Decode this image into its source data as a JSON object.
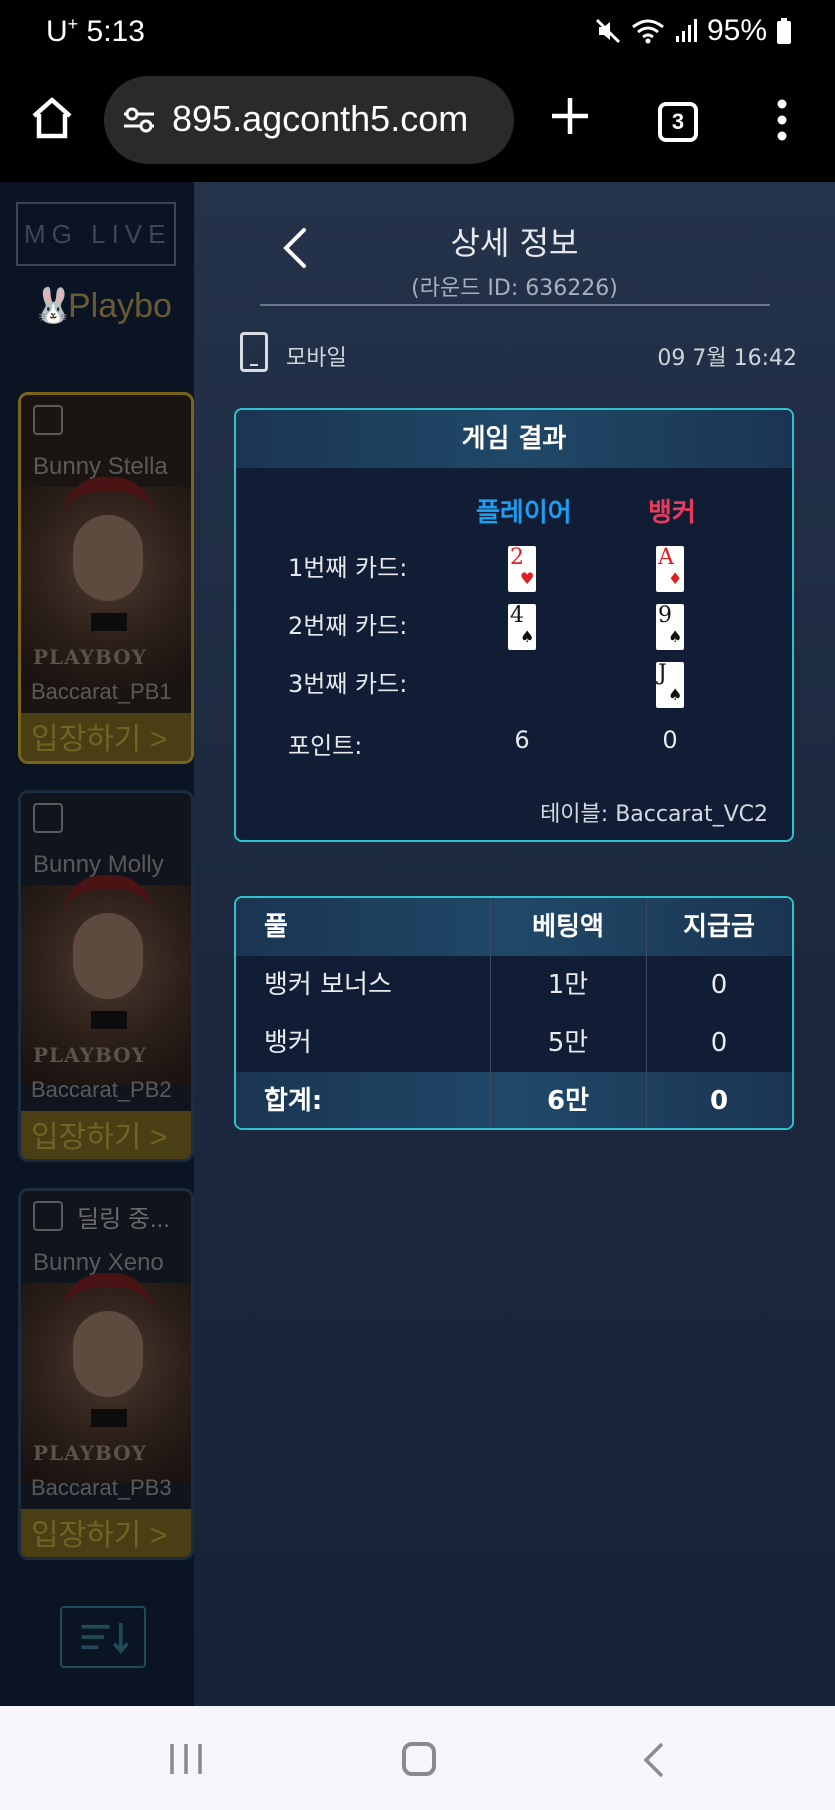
{
  "status_bar": {
    "carrier": "U",
    "carrier_sup": "+",
    "time": "5:13",
    "battery": "95%"
  },
  "browser": {
    "url": "895.agconth5.com",
    "tab_count": "3",
    "icons": [
      "home-icon",
      "site-settings-icon",
      "new-tab-icon",
      "tabs-icon",
      "more-menu-icon"
    ]
  },
  "lobby": {
    "logo": "MG LIVE",
    "category": "Playbo",
    "cards": [
      {
        "dealer": "Bunny Stella",
        "brand": "PLAYBOY",
        "table": "Baccarat_PB1",
        "enter": "입장하기 >",
        "status": ""
      },
      {
        "dealer": "Bunny Molly",
        "brand": "PLAYBOY",
        "table": "Baccarat_PB2",
        "enter": "입장하기 >",
        "status": ""
      },
      {
        "dealer": "Bunny Xeno",
        "brand": "PLAYBOY",
        "table": "Baccarat_PB3",
        "enter": "입장하기 >",
        "status": "딜링 중..."
      }
    ]
  },
  "detail": {
    "title": "상세 정보",
    "round_id": "(라운드 ID: 636226)",
    "device": "모바일",
    "datetime": "09  7월 16:42",
    "result": {
      "header": "게임 결과",
      "player_label": "플레이어",
      "banker_label": "뱅커",
      "rows": [
        {
          "label": "1번째  카드:"
        },
        {
          "label": "2번째 카드:"
        },
        {
          "label": "3번째 카드:"
        },
        {
          "label": "포인트:"
        }
      ],
      "player_cards": [
        {
          "rank": "2",
          "suit": "♥"
        },
        {
          "rank": "4",
          "suit": "♠"
        }
      ],
      "banker_cards": [
        {
          "rank": "A",
          "suit": "♦"
        },
        {
          "rank": "9",
          "suit": "♠"
        },
        {
          "rank": "J",
          "suit": "♠"
        }
      ],
      "player_points": "6",
      "banker_points": "0",
      "table": "테이블: Baccarat_VC2"
    },
    "bets": {
      "headers": [
        "풀",
        "베팅액",
        "지급금"
      ],
      "rows": [
        [
          "뱅커 보너스",
          "1만",
          "0"
        ],
        [
          "뱅커",
          "5만",
          "0"
        ]
      ],
      "total": [
        "합계:",
        "6만",
        "0"
      ]
    }
  },
  "colors": {
    "accent": "#2ec2cc",
    "player": "#1e9cf0",
    "banker": "#ea3a5c"
  }
}
